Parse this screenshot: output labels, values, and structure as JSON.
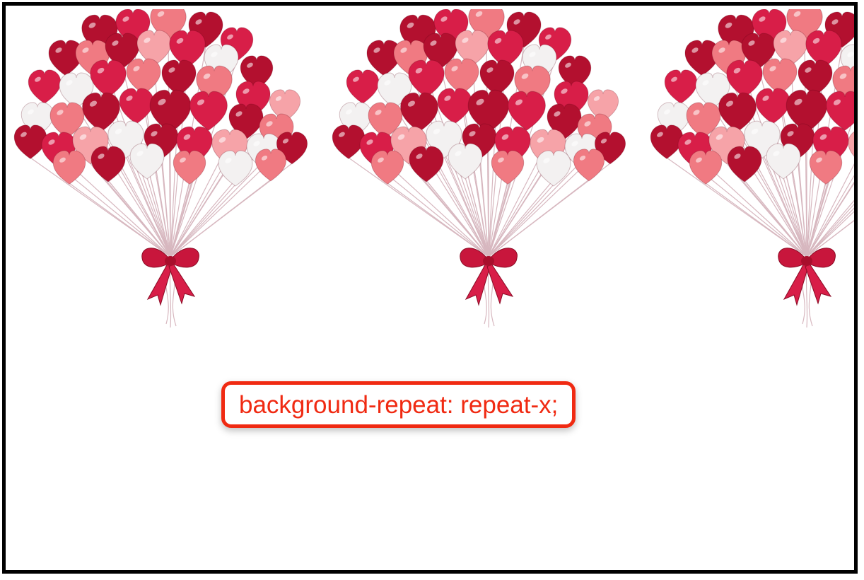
{
  "caption": {
    "text": "background-repeat: repeat-x;",
    "color": "#f02a12"
  },
  "background_image": {
    "icon": "heart-balloon-bouquet-icon",
    "tile_count_visible": 3,
    "colors": [
      "#c8163c",
      "#f07a82",
      "#f5f5f5",
      "#e23a5a"
    ]
  }
}
